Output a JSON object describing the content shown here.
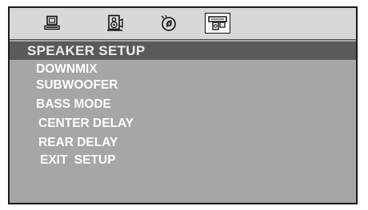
{
  "tabs": [
    {
      "icon": "monitor-icon",
      "active": false
    },
    {
      "icon": "speaker-icon",
      "active": false
    },
    {
      "icon": "disc-audio-icon",
      "active": false
    },
    {
      "icon": "speaker-setup-icon",
      "active": true
    }
  ],
  "menu": {
    "title": "SPEAKER SETUP",
    "items": [
      {
        "label": "DOWNMIX"
      },
      {
        "label": "SUBWOOFER"
      },
      {
        "label": "BASS MODE"
      },
      {
        "label": "CENTER DELAY"
      },
      {
        "label": "REAR DELAY"
      },
      {
        "label": "EXIT  SETUP"
      }
    ]
  },
  "colors": {
    "panel": "#a6a6a6",
    "icon_bar": "#d8d8d8",
    "title_bar": "#5a5a5a",
    "text": "#ffffff"
  }
}
